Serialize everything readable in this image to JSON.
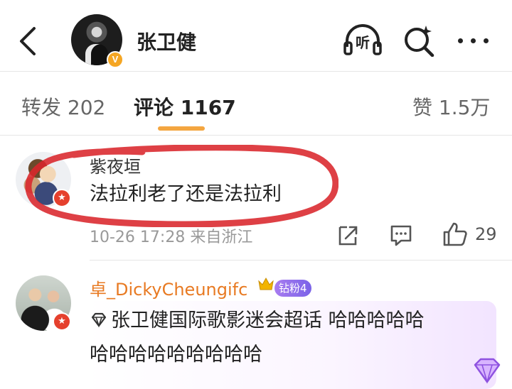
{
  "header": {
    "title": "张卫健",
    "listen_label": "听",
    "verified_badge": "V"
  },
  "tabs": [
    {
      "label": "转发 202"
    },
    {
      "label": "评论 1167"
    },
    {
      "label": "赞 1.5万"
    }
  ],
  "comments": [
    {
      "user": "紫夜垣",
      "text": "法拉利老了还是法拉利",
      "meta": "10-26 17:28 来自浙江",
      "likes": "29",
      "highlighted": true,
      "badge_icon": "star-icon"
    },
    {
      "user": "卓_DickyCheungifc",
      "fan_badge": "钻粉4",
      "topic_link": "张卫健国际歌影迷会超话",
      "text_line1_rest": " 哈哈哈哈哈",
      "text_line2": "哈哈哈哈哈哈哈哈哈",
      "badge_icon": "star-icon"
    }
  ],
  "colors": {
    "accent": "#f4a640",
    "username_highlight": "#e87a22",
    "highlight_circle": "#d9262b",
    "verified": "#f5a623",
    "badge_red": "#e5402d",
    "fan_badge": "#8f6ff0"
  },
  "icons": [
    "back-arrow-icon",
    "headphones-icon",
    "search-sparkle-icon",
    "more-icon",
    "share-icon",
    "comment-icon",
    "thumbs-up-icon",
    "crown-icon",
    "diamond-icon"
  ]
}
